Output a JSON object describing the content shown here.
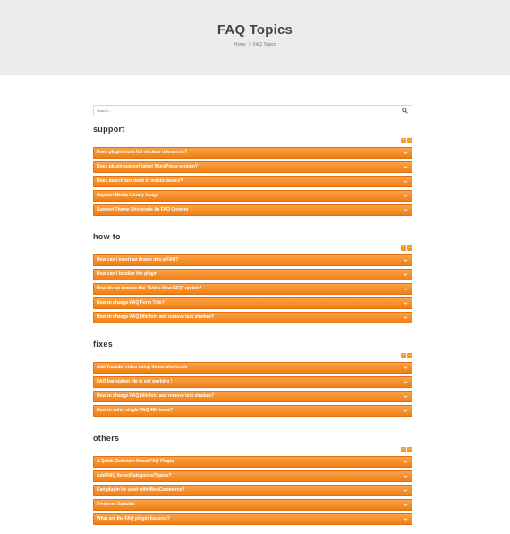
{
  "page": {
    "title": "FAQ Topics",
    "breadcrumb": {
      "home": "Home",
      "separator": "/",
      "current": "FAQ Topics"
    }
  },
  "search": {
    "placeholder": "Search..."
  },
  "colors": {
    "accent": "#f7941d",
    "hero_bg": "#ececec",
    "heading": "#333333"
  },
  "controls": {
    "expand": "+",
    "collapse": "−"
  },
  "sections": [
    {
      "title": "support",
      "items": [
        "Does plugin has a list of class references?",
        "Does plugin support latest WordPress version?",
        "Does search box work in mobile device?",
        "Support Media Library Image",
        "Support Theme Shortcode As FAQ Content"
      ]
    },
    {
      "title": "how to",
      "items": [
        "How can I insert an iframe into a FAQ?",
        "How can I localize the plugin",
        "How do we remove the \"Add a New FAQ\" option?",
        "How to change FAQ Form Title?",
        "How to change FAQ title font and remove text shadow?"
      ]
    },
    {
      "title": "fixes",
      "items": [
        "Add Youtube video using theme shortcode",
        "FAQ translation file is not working !",
        "How to change FAQ title font and remove text shadow?",
        "How to solve single FAQ 404 issue?"
      ]
    },
    {
      "title": "others",
      "items": [
        "A Quick Overview About FAQ Plugin",
        "Add FAQ Items/Categories/Topics?",
        "Can plugin be used with WooCommerce?",
        "Frequent Updates",
        "What are the FAQ plugin features?"
      ]
    }
  ]
}
